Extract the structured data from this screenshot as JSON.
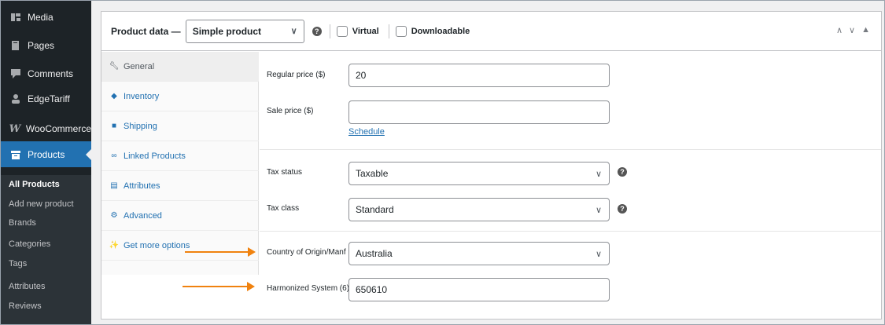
{
  "sidebar": {
    "menu": [
      {
        "label": "Media",
        "icon": "media-icon"
      },
      {
        "label": "Pages",
        "icon": "pages-icon"
      },
      {
        "label": "Comments",
        "icon": "comments-icon"
      },
      {
        "label": "EdgeTariff",
        "icon": "user-icon"
      },
      {
        "label": "WooCommerce",
        "icon": "woocommerce-icon"
      },
      {
        "label": "Products",
        "icon": "archive-icon"
      }
    ],
    "submenu": [
      {
        "label": "All Products"
      },
      {
        "label": "Add new product"
      },
      {
        "label": "Brands"
      },
      {
        "label": "Categories"
      },
      {
        "label": "Tags"
      },
      {
        "label": "Attributes"
      },
      {
        "label": "Reviews"
      }
    ],
    "active_color": "#2271b1"
  },
  "product_data": {
    "title": "Product data —",
    "type_select": "Simple product",
    "virtual_label": "Virtual",
    "downloadable_label": "Downloadable",
    "virtual_checked": false,
    "downloadable_checked": false
  },
  "tabs": [
    {
      "label": "General",
      "icon": "wrench-icon"
    },
    {
      "label": "Inventory",
      "icon": "tag-icon"
    },
    {
      "label": "Shipping",
      "icon": "truck-icon"
    },
    {
      "label": "Linked Products",
      "icon": "link-icon"
    },
    {
      "label": "Attributes",
      "icon": "list-icon"
    },
    {
      "label": "Advanced",
      "icon": "gear-icon"
    },
    {
      "label": "Get more options",
      "icon": "plugin-icon"
    }
  ],
  "general": {
    "regular_price": {
      "label": "Regular price ($)",
      "value": "20"
    },
    "sale_price": {
      "label": "Sale price ($)",
      "value": ""
    },
    "schedule_link": "Schedule",
    "tax_status": {
      "label": "Tax status",
      "value": "Taxable"
    },
    "tax_class": {
      "label": "Tax class",
      "value": "Standard"
    },
    "country_origin": {
      "label": "Country of Origin/Manf",
      "value": "Australia"
    },
    "harmonized_system": {
      "label": "Harmonized System (6)",
      "value": "650610"
    }
  },
  "annotation_color": "#f0820f"
}
